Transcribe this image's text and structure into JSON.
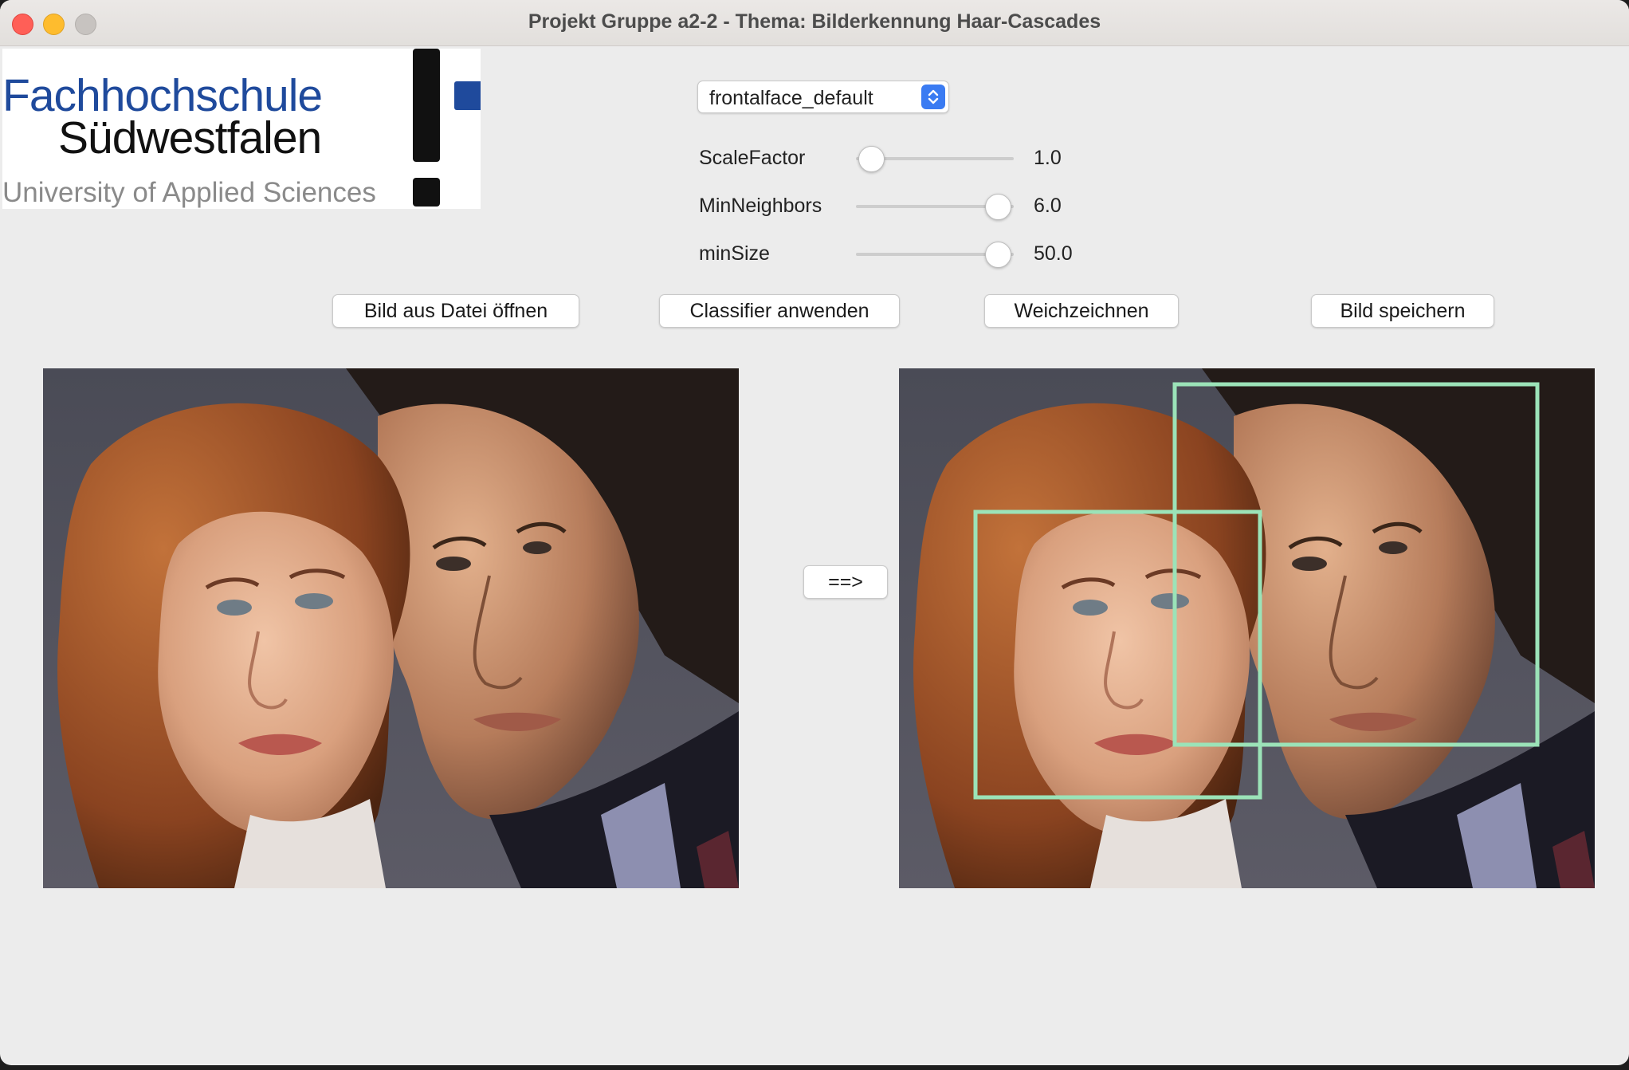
{
  "window": {
    "title": "Projekt Gruppe a2-2 - Thema: Bilderkennung Haar-Cascades"
  },
  "logo": {
    "line1": "Fachhochschule",
    "line2": "Südwestfalen",
    "line3": "University of Applied Sciences"
  },
  "classifier_select": {
    "value": "frontalface_default"
  },
  "sliders": [
    {
      "label": "ScaleFactor",
      "value": "1.0",
      "position": 0.1
    },
    {
      "label": "MinNeighbors",
      "value": "6.0",
      "position": 0.9
    },
    {
      "label": "minSize",
      "value": "50.0",
      "position": 0.9
    }
  ],
  "buttons": {
    "open": "Bild aus Datei öffnen",
    "apply": "Classifier anwenden",
    "blur": "Weichzeichnen",
    "save": "Bild speichern",
    "arrow": "==>"
  },
  "colors": {
    "detection_box": "#9be3b8",
    "select_accent": "#3a7bf2"
  },
  "icons": {
    "select_arrow": "updown-chevron-icon"
  }
}
